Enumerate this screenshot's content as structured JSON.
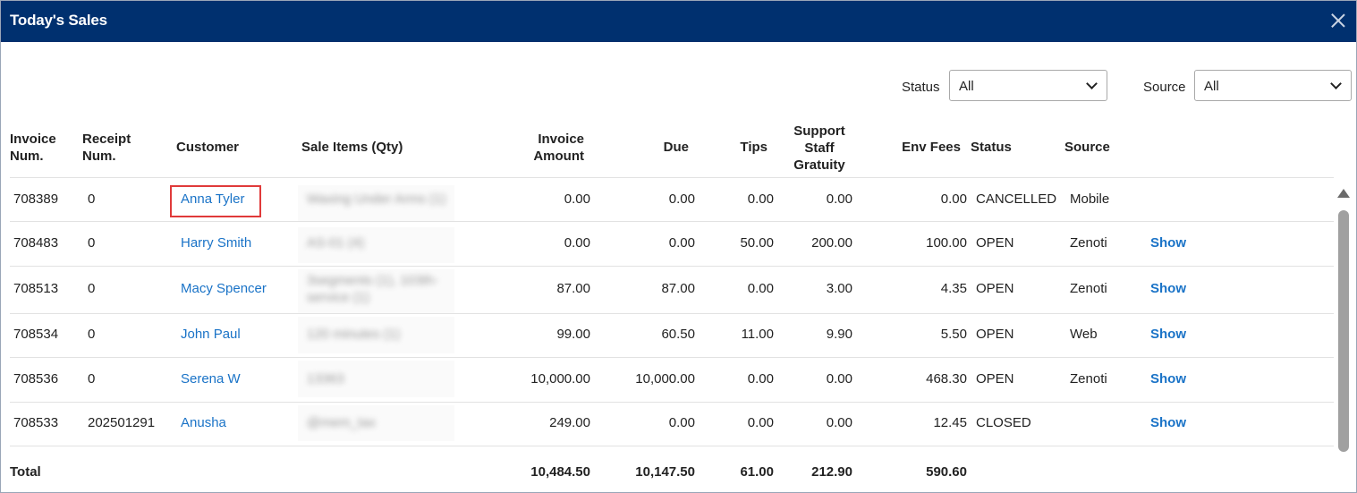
{
  "dialog": {
    "title": "Today's Sales",
    "close_icon": "close-icon"
  },
  "filters": {
    "status_label": "Status",
    "status_value": "All",
    "source_label": "Source",
    "source_value": "All"
  },
  "columns": {
    "invoice_num": [
      "Invoice",
      "Num."
    ],
    "receipt_num": [
      "Receipt",
      "Num."
    ],
    "customer": "Customer",
    "sale_items": "Sale Items (Qty)",
    "invoice_amount": [
      "Invoice",
      "Amount"
    ],
    "due": "Due",
    "tips": "Tips",
    "gratuity": [
      "Support",
      "Staff",
      "Gratuity"
    ],
    "env_fees": "Env Fees",
    "status": "Status",
    "source": "Source"
  },
  "rows": [
    {
      "invoice": "708389",
      "receipt": "0",
      "customer": "Anna Tyler",
      "items": "Waxing Under Arms (1)",
      "items2": "",
      "amount": "0.00",
      "due": "0.00",
      "tips": "0.00",
      "gratuity": "0.00",
      "env": "0.00",
      "status": "CANCELLED",
      "source": "Mobile",
      "action": ""
    },
    {
      "invoice": "708483",
      "receipt": "0",
      "customer": "Harry Smith",
      "items": "AS-01 (4)",
      "items2": "",
      "amount": "0.00",
      "due": "0.00",
      "tips": "50.00",
      "gratuity": "200.00",
      "env": "100.00",
      "status": "OPEN",
      "source": "Zenoti",
      "action": "Show"
    },
    {
      "invoice": "708513",
      "receipt": "0",
      "customer": "Macy Spencer",
      "items": "3segments (1), 103th-",
      "items2": "service (1)",
      "amount": "87.00",
      "due": "87.00",
      "tips": "0.00",
      "gratuity": "3.00",
      "env": "4.35",
      "status": "OPEN",
      "source": "Zenoti",
      "action": "Show"
    },
    {
      "invoice": "708534",
      "receipt": "0",
      "customer": "John Paul",
      "items": "120 minutes (1)",
      "items2": "",
      "amount": "99.00",
      "due": "60.50",
      "tips": "11.00",
      "gratuity": "9.90",
      "env": "5.50",
      "status": "OPEN",
      "source": "Web",
      "action": "Show"
    },
    {
      "invoice": "708536",
      "receipt": "0",
      "customer": "Serena W",
      "items": "13363",
      "items2": "",
      "amount": "10,000.00",
      "due": "10,000.00",
      "tips": "0.00",
      "gratuity": "0.00",
      "env": "468.30",
      "status": "OPEN",
      "source": "Zenoti",
      "action": "Show"
    },
    {
      "invoice": "708533",
      "receipt": "202501291",
      "customer": "Anusha",
      "items": "@mem_tax",
      "items2": "",
      "amount": "249.00",
      "due": "0.00",
      "tips": "0.00",
      "gratuity": "0.00",
      "env": "12.45",
      "status": "CLOSED",
      "source": "",
      "action": "Show"
    }
  ],
  "totals": {
    "label": "Total",
    "amount": "10,484.50",
    "due": "10,147.50",
    "tips": "61.00",
    "gratuity": "212.90",
    "env": "590.60"
  }
}
